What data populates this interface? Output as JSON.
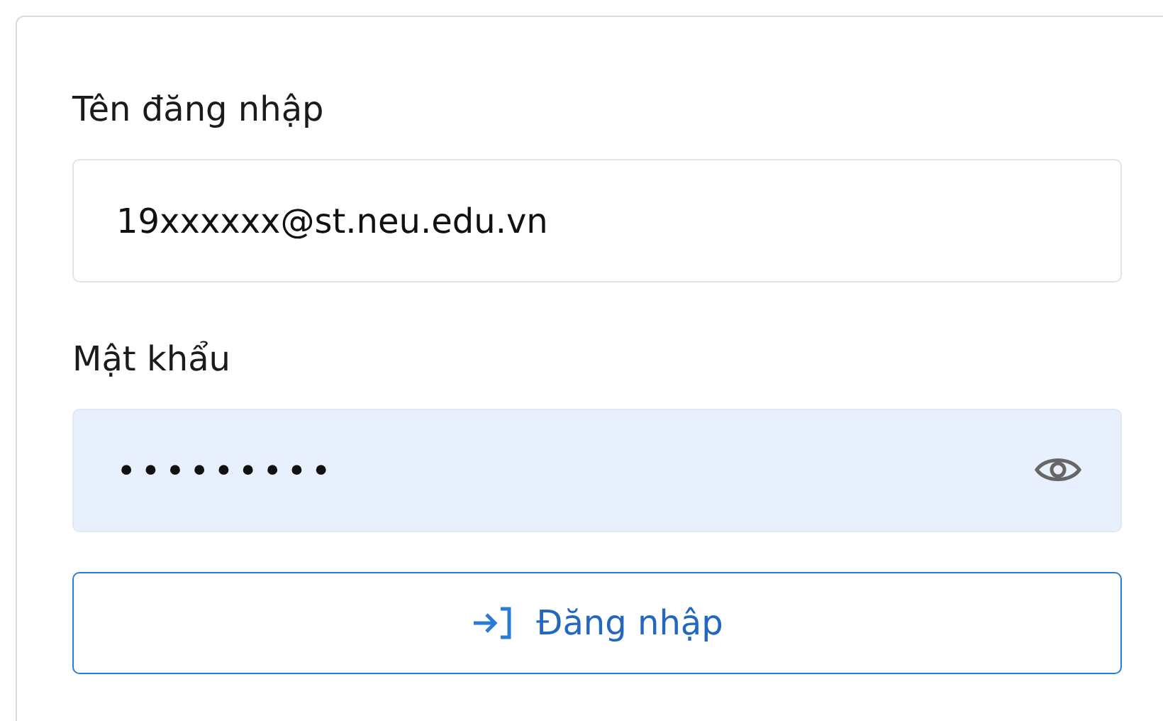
{
  "form": {
    "fields": [
      {
        "kind": "text",
        "label": "Tên đăng nhập",
        "value": "19xxxxxx@st.neu.edu.vn",
        "autofilled": false
      },
      {
        "kind": "password",
        "label": "Mật khẩu",
        "value": "•••••••••",
        "autofilled": true
      }
    ],
    "submit": {
      "label": "Đăng nhập"
    }
  }
}
